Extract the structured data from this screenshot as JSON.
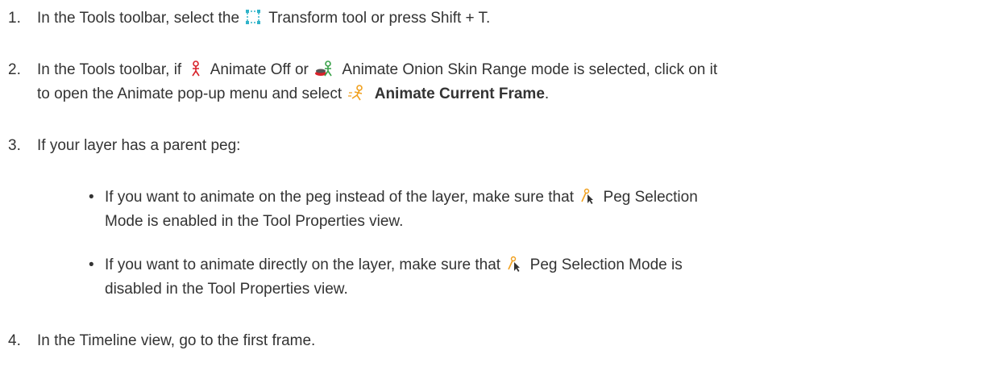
{
  "steps": [
    {
      "number": "1.",
      "parts": {
        "a": "In the Tools toolbar, select the",
        "b": "Transform tool or press Shift + T."
      },
      "icons": [
        "transform-tool-icon"
      ]
    },
    {
      "number": "2.",
      "parts": {
        "a": "In the Tools toolbar, if",
        "b": "Animate Off or",
        "c": "Animate Onion Skin Range mode is selected, click on it",
        "d": "to open the Animate pop-up menu and select",
        "e": "Animate Current Frame",
        "f": "."
      },
      "icons": [
        "animate-off-icon",
        "animate-onion-skin-range-icon",
        "animate-current-frame-icon"
      ]
    },
    {
      "number": "3.",
      "parts": {
        "a": "If your layer has a parent peg:"
      },
      "bullets": [
        {
          "a": "If you want to animate on the peg instead of the layer, make sure that",
          "b": "Peg Selection",
          "c": "Mode is enabled in the Tool Properties view."
        },
        {
          "a": "If you want to animate directly on the layer, make sure that",
          "b": "Peg Selection Mode is",
          "c": "disabled in the Tool Properties view."
        }
      ],
      "icons": [
        "peg-selection-mode-icon"
      ]
    },
    {
      "number": "4.",
      "parts": {
        "a": "In the Timeline view, go to the first frame."
      }
    }
  ],
  "colors": {
    "text": "#333333",
    "transform_icon": "#2fb3c9",
    "animate_red": "#d8222a",
    "animate_orange": "#f0a01e",
    "animate_green": "#3aa24a"
  }
}
